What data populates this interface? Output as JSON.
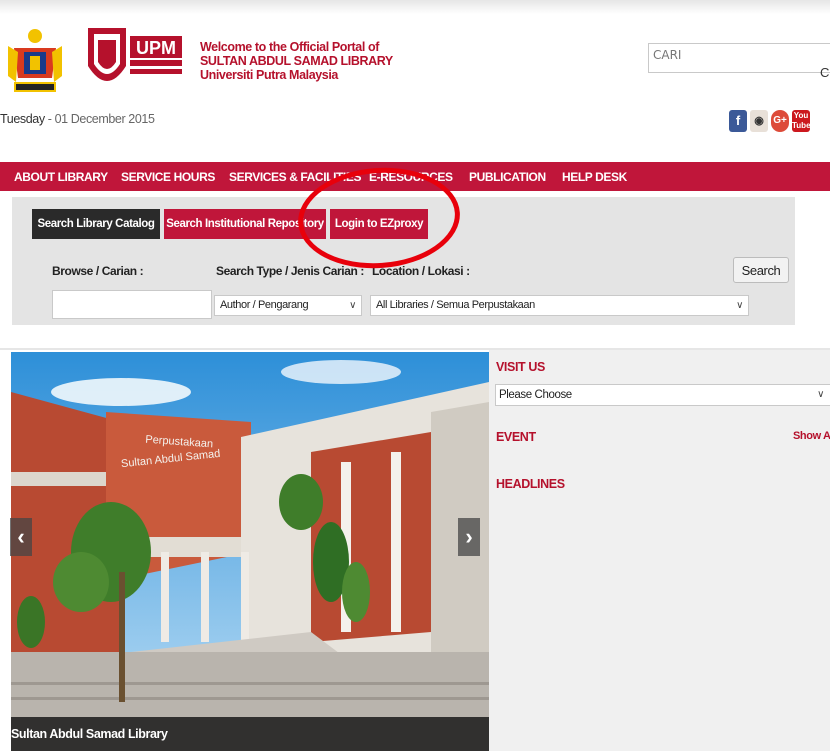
{
  "header": {
    "welcome_line1": "Welcome to the Official Portal of",
    "welcome_line2": "SULTAN ABDUL SAMAD LIBRARY",
    "welcome_line3": "Universiti Putra Malaysia",
    "logo_text": "UPM",
    "search_placeholder": "CARI",
    "date_day": "Tuesday",
    "date_rest": " - 01 December 2015",
    "social": [
      {
        "name": "facebook-icon",
        "glyph": "f",
        "color": "#3b5998"
      },
      {
        "name": "instagram-icon",
        "glyph": "◉",
        "color": "#6a4c3a"
      },
      {
        "name": "google-plus-icon",
        "glyph": "G+",
        "color": "#dd4b39"
      },
      {
        "name": "youtube-icon",
        "glyph": "You",
        "color": "#cc181e"
      }
    ]
  },
  "nav": {
    "items": [
      "ABOUT LIBRARY",
      "SERVICE HOURS",
      "SERVICES & FACILITIES",
      "E-RESOURCES",
      "PUBLICATION",
      "HELP DESK"
    ]
  },
  "search_panel": {
    "tabs": [
      "Search Library Catalog",
      "Search Institutional Repository",
      "Login to EZproxy"
    ],
    "browse_label": "Browse / Carian :",
    "type_label": "Search Type / Jenis Carian :",
    "location_label": "Location / Lokasi :",
    "search_button": "Search",
    "type_value": "Author / Pengarang",
    "location_value": "All Libraries / Semua Perpustakaan"
  },
  "slider": {
    "caption": "Sultan Abdul Samad Library",
    "building_sign_line1": "Perpustakaan",
    "building_sign_line2": "Sultan Abdul Samad",
    "prev": "‹",
    "next": "›"
  },
  "sidebar": {
    "visit_us": "VISIT US",
    "visit_select": "Please Choose",
    "event": "EVENT",
    "show_all": "Show All",
    "headlines": "HEADLINES"
  },
  "colors": {
    "brand_red": "#c0163a",
    "annotation_red": "#e8000b"
  }
}
